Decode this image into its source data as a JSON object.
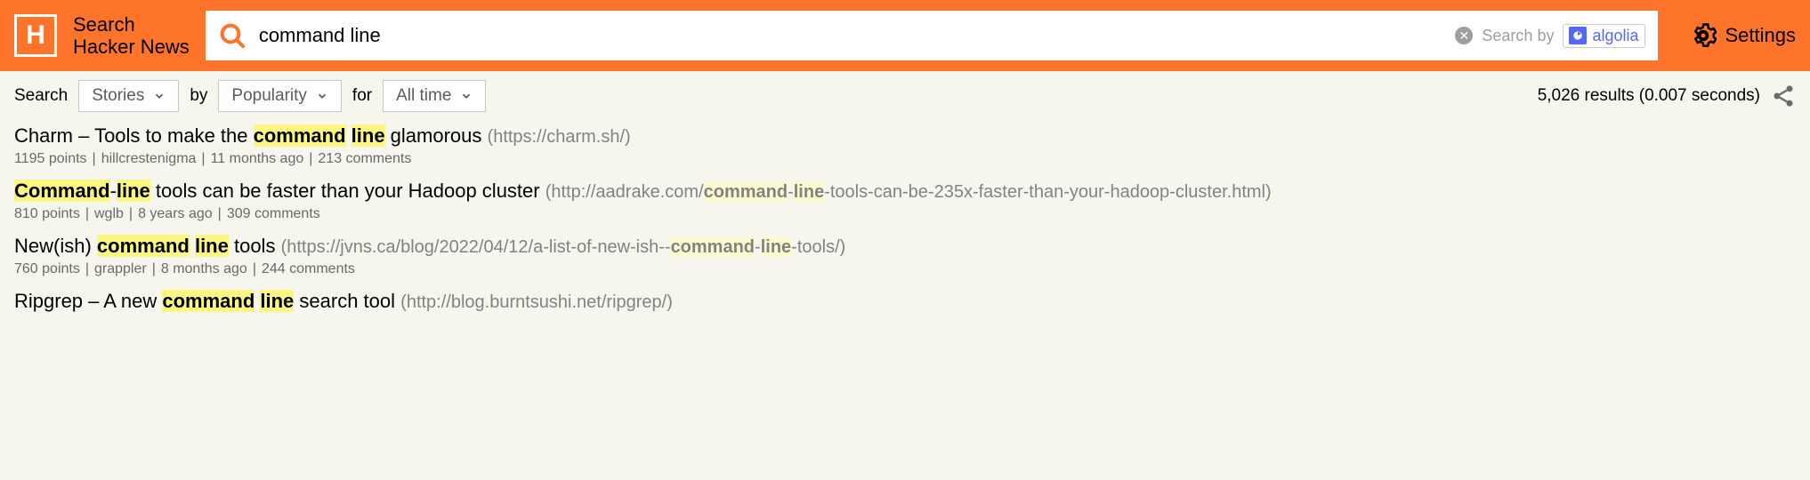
{
  "site": {
    "line1": "Search",
    "line2": "Hacker News",
    "logo_letter": "H"
  },
  "search": {
    "value": "command line",
    "by_label": "Search by",
    "algolia": "algolia"
  },
  "settings_label": "Settings",
  "filters": {
    "search_label": "Search",
    "stories": "Stories",
    "by_label": "by",
    "popularity": "Popularity",
    "for_label": "for",
    "alltime": "All time"
  },
  "results_info": "5,026 results (0.007 seconds)",
  "stories": [
    {
      "title_pre": "Charm – Tools to make the ",
      "title_hl1": "command",
      "title_mid": " ",
      "title_hl2": "line",
      "title_post": " glamorous",
      "url_pre": " (https://charm.sh/)",
      "points": "1195 points",
      "author": "hillcrestenigma",
      "age": "11 months ago",
      "comments": "213 comments"
    },
    {
      "title_hl_a": "Command",
      "title_sep_a": "-",
      "title_hl_b": "line",
      "title_post": " tools can be faster than your Hadoop cluster",
      "url_pre": " (http://aadrake.com/",
      "url_hl1": "command",
      "url_sep": "-",
      "url_hl2": "line",
      "url_post": "-tools-can-be-235x-faster-than-your-hadoop-cluster.html)",
      "points": "810 points",
      "author": "wglb",
      "age": "8 years ago",
      "comments": "309 comments"
    },
    {
      "title_pre": "New(ish) ",
      "title_hl1": "command",
      "title_mid": " ",
      "title_hl2": "line",
      "title_post": " tools",
      "url_pre": " (https://jvns.ca/blog/2022/04/12/a-list-of-new-ish--",
      "url_hl1": "command",
      "url_sep": "-",
      "url_hl2": "line",
      "url_post": "-tools/)",
      "points": "760 points",
      "author": "grappler",
      "age": "8 months ago",
      "comments": "244 comments"
    },
    {
      "title_pre": "Ripgrep – A new ",
      "title_hl1": "command",
      "title_mid": " ",
      "title_hl2": "line",
      "title_post": " search tool",
      "url_pre": " (http://blog.burntsushi.net/ripgrep/)",
      "points": "",
      "author": "",
      "age": "",
      "comments": ""
    }
  ]
}
